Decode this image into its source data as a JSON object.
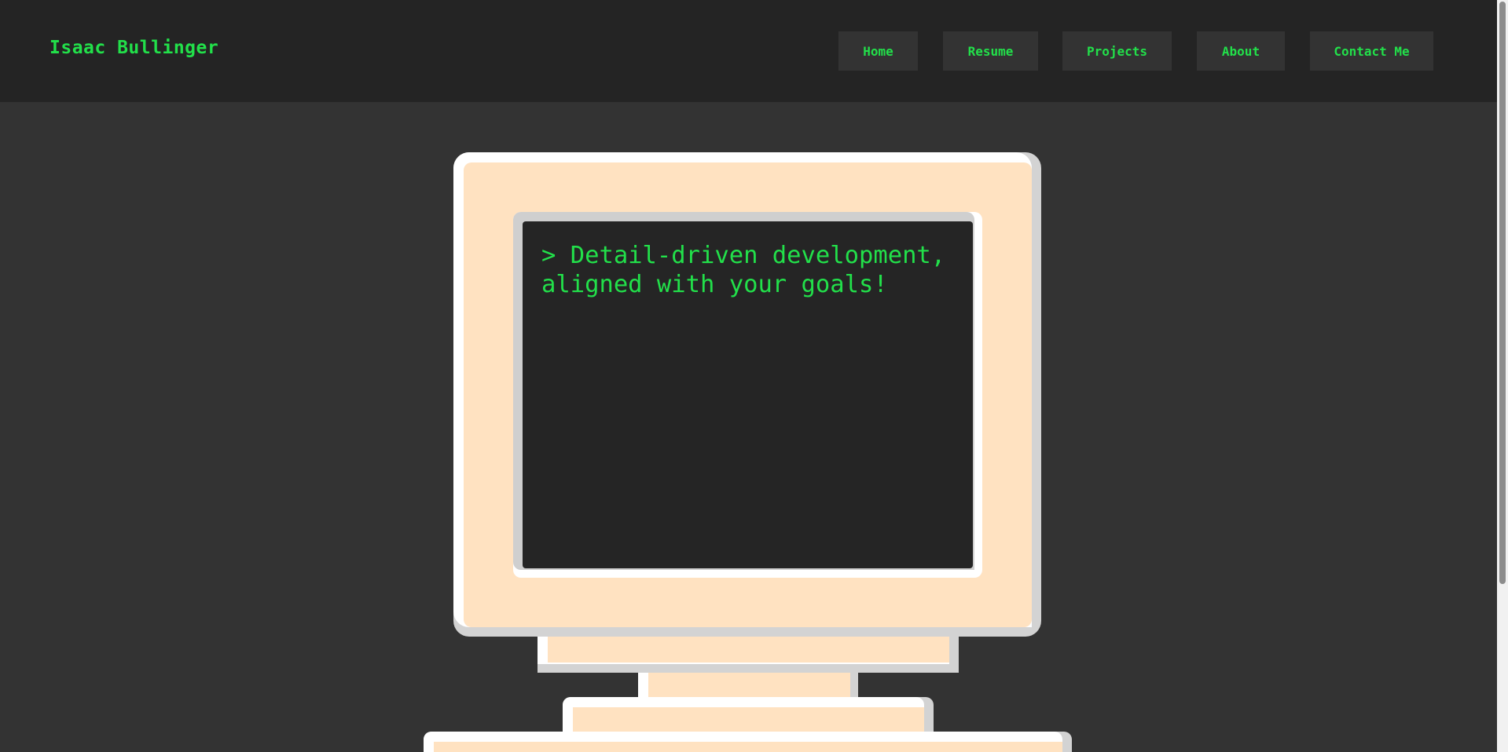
{
  "header": {
    "site_title": "Isaac Bullinger"
  },
  "nav": {
    "items": [
      {
        "label": "Home"
      },
      {
        "label": "Resume"
      },
      {
        "label": "Projects"
      },
      {
        "label": "About"
      },
      {
        "label": "Contact Me"
      }
    ]
  },
  "hero": {
    "screen_text": "> Detail-driven development,\naligned with your goals!"
  },
  "colors": {
    "accent_green": "#22e04a",
    "header_bg": "#242424",
    "page_bg": "#333333",
    "monitor_beige": "#ffe2c1",
    "screen_bg": "#252525"
  },
  "icons": {
    "illustration": "retro-computer-monitor"
  }
}
